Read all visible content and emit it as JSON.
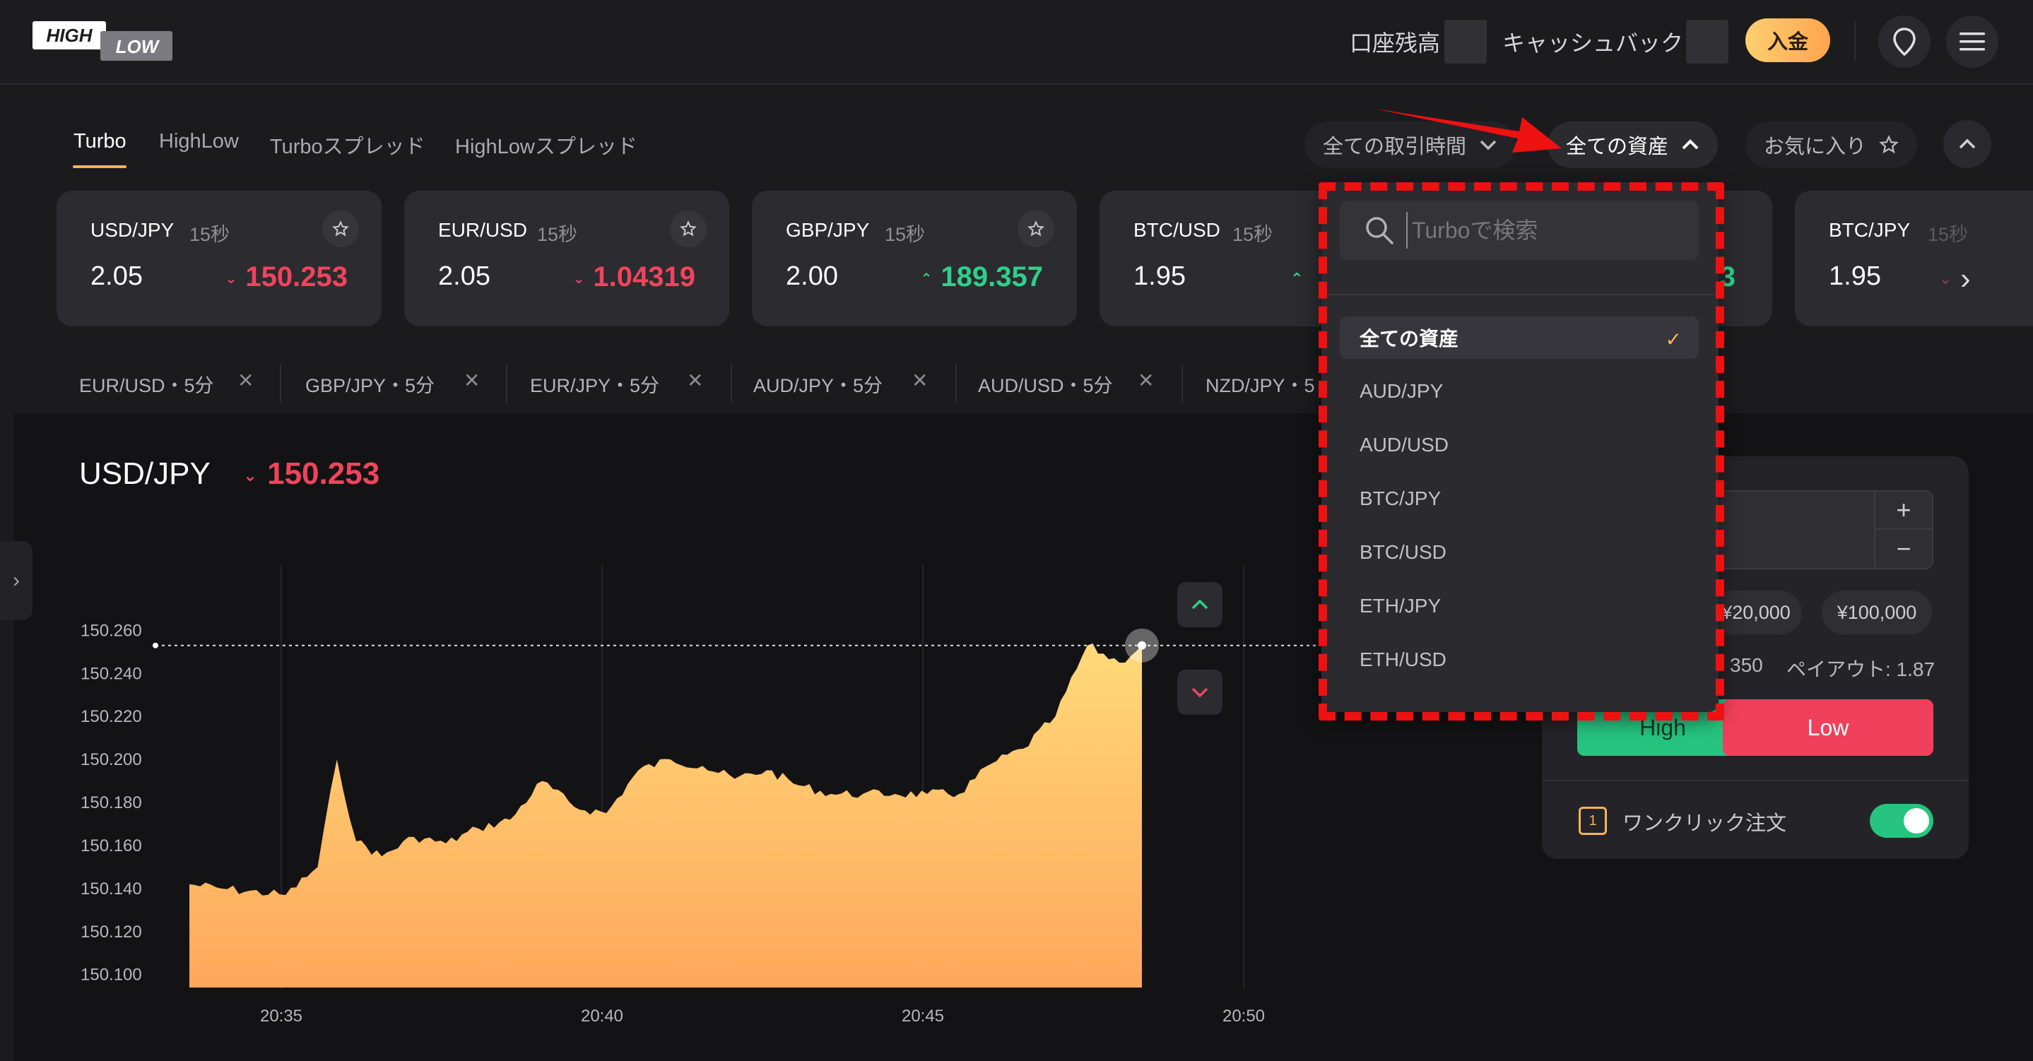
{
  "header": {
    "logo_text_top": "HIGH",
    "logo_text_bottom": "LOW",
    "balance_label": "口座残高",
    "cashback_label": "キャッシュバック",
    "deposit_label": "入金",
    "icons": [
      "location-icon",
      "menu-icon"
    ]
  },
  "tabs": [
    {
      "label": "Turbo",
      "active": true
    },
    {
      "label": "HighLow",
      "active": false
    },
    {
      "label": "Turboスプレッド",
      "active": false
    },
    {
      "label": "HighLowスプレッド",
      "active": false
    }
  ],
  "filters": {
    "time_label": "全ての取引時間",
    "asset_label": "全ての資産",
    "favorites_label": "お気に入り"
  },
  "cards": [
    {
      "pair": "USD/JPY",
      "duration": "15秒",
      "payout": "2.05",
      "price": "150.253",
      "dir": "down"
    },
    {
      "pair": "EUR/USD",
      "duration": "15秒",
      "payout": "2.05",
      "price": "1.04319",
      "dir": "down"
    },
    {
      "pair": "GBP/JPY",
      "duration": "15秒",
      "payout": "2.00",
      "price": "189.357",
      "dir": "up"
    },
    {
      "pair": "BTC/USD",
      "duration": "15秒",
      "payout": "1.95",
      "price": "",
      "dir": "up"
    },
    {
      "pair": "",
      "duration": "",
      "payout": "",
      "price": "3",
      "dir": "up"
    },
    {
      "pair": "BTC/JPY",
      "duration": "15秒",
      "payout": "1.95",
      "price": "",
      "dir": "down"
    }
  ],
  "recent": [
    {
      "label": "EUR/USD・5分"
    },
    {
      "label": "GBP/JPY・5分"
    },
    {
      "label": "EUR/JPY・5分"
    },
    {
      "label": "AUD/JPY・5分"
    },
    {
      "label": "AUD/USD・5分"
    },
    {
      "label": "NZD/JPY・5"
    }
  ],
  "chart": {
    "pair": "USD/JPY",
    "price": "150.253",
    "y_ticks": [
      "150.260",
      "150.240",
      "150.220",
      "150.200",
      "150.180",
      "150.160",
      "150.140",
      "150.120",
      "150.100"
    ],
    "x_ticks": [
      "20:35",
      "20:40",
      "20:45",
      "20:50"
    ]
  },
  "chart_data": {
    "type": "area",
    "title": "USD/JPY",
    "ylim": [
      150.094,
      150.268
    ],
    "x": [
      0,
      0.5,
      1.5,
      2.0,
      2.3,
      2.6,
      3.0,
      3.5,
      4.0,
      4.5,
      5.0,
      5.5,
      6.0,
      6.5,
      7.0,
      7.5,
      8.0,
      8.5,
      9.0,
      9.5,
      10.0,
      10.5,
      11.0,
      11.5,
      12.0,
      12.5,
      13.0,
      13.5,
      14.0,
      14.5,
      14.85
    ],
    "values": [
      150.142,
      150.14,
      150.137,
      150.15,
      150.2,
      150.162,
      150.155,
      150.164,
      150.161,
      150.168,
      150.172,
      150.19,
      150.178,
      150.175,
      150.195,
      150.2,
      150.197,
      150.191,
      150.195,
      150.188,
      150.184,
      150.184,
      150.184,
      150.184,
      150.184,
      150.198,
      150.205,
      150.22,
      150.253,
      150.245,
      150.253
    ]
  },
  "trade": {
    "presets": [
      "¥20,000",
      "¥100,000"
    ],
    "payout_partial": "350",
    "payout_label": "ペイアウト: 1.87",
    "high_label": "High",
    "low_label": "Low",
    "oneclick_label": "ワンクリック注文",
    "oneclick_icon_text": "1",
    "oneclick_on": true
  },
  "dropdown": {
    "search_placeholder": "Turboで検索",
    "items": [
      {
        "label": "全ての資産",
        "selected": true
      },
      {
        "label": "AUD/JPY",
        "selected": false
      },
      {
        "label": "AUD/USD",
        "selected": false
      },
      {
        "label": "BTC/JPY",
        "selected": false
      },
      {
        "label": "BTC/USD",
        "selected": false
      },
      {
        "label": "ETH/JPY",
        "selected": false
      },
      {
        "label": "ETH/USD",
        "selected": false
      }
    ]
  },
  "colors": {
    "accent": "#f7b35a",
    "down": "#f0445c",
    "up": "#2fd08b",
    "annotation": "#ee1111"
  }
}
